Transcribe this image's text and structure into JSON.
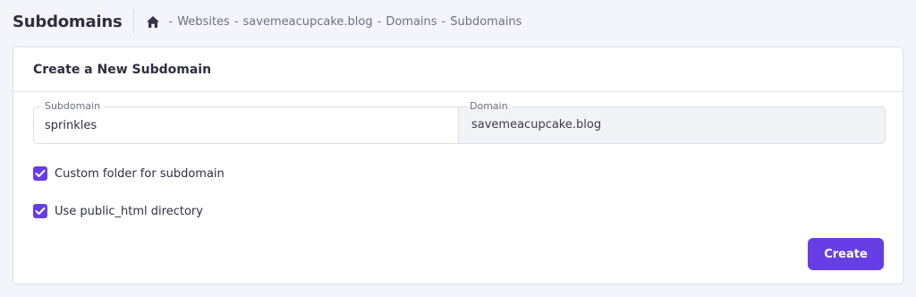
{
  "header": {
    "title": "Subdomains",
    "breadcrumb": [
      {
        "label": "Websites"
      },
      {
        "label": "savemeacupcake.blog"
      },
      {
        "label": "Domains"
      },
      {
        "label": "Subdomains"
      }
    ],
    "separator": "-"
  },
  "card": {
    "title": "Create a New Subdomain",
    "subdomain_field": {
      "label": "Subdomain",
      "value": "sprinkles"
    },
    "domain_field": {
      "label": "Domain",
      "value": "savemeacupcake.blog"
    },
    "options": [
      {
        "label": "Custom folder for subdomain",
        "checked": true
      },
      {
        "label": "Use public_html directory",
        "checked": true
      }
    ],
    "create_label": "Create"
  },
  "colors": {
    "accent": "#673de6",
    "page_bg": "#f4f5fb"
  },
  "icons": {
    "breadcrumb_home": "home-icon",
    "checkbox_checked": "check-icon"
  }
}
